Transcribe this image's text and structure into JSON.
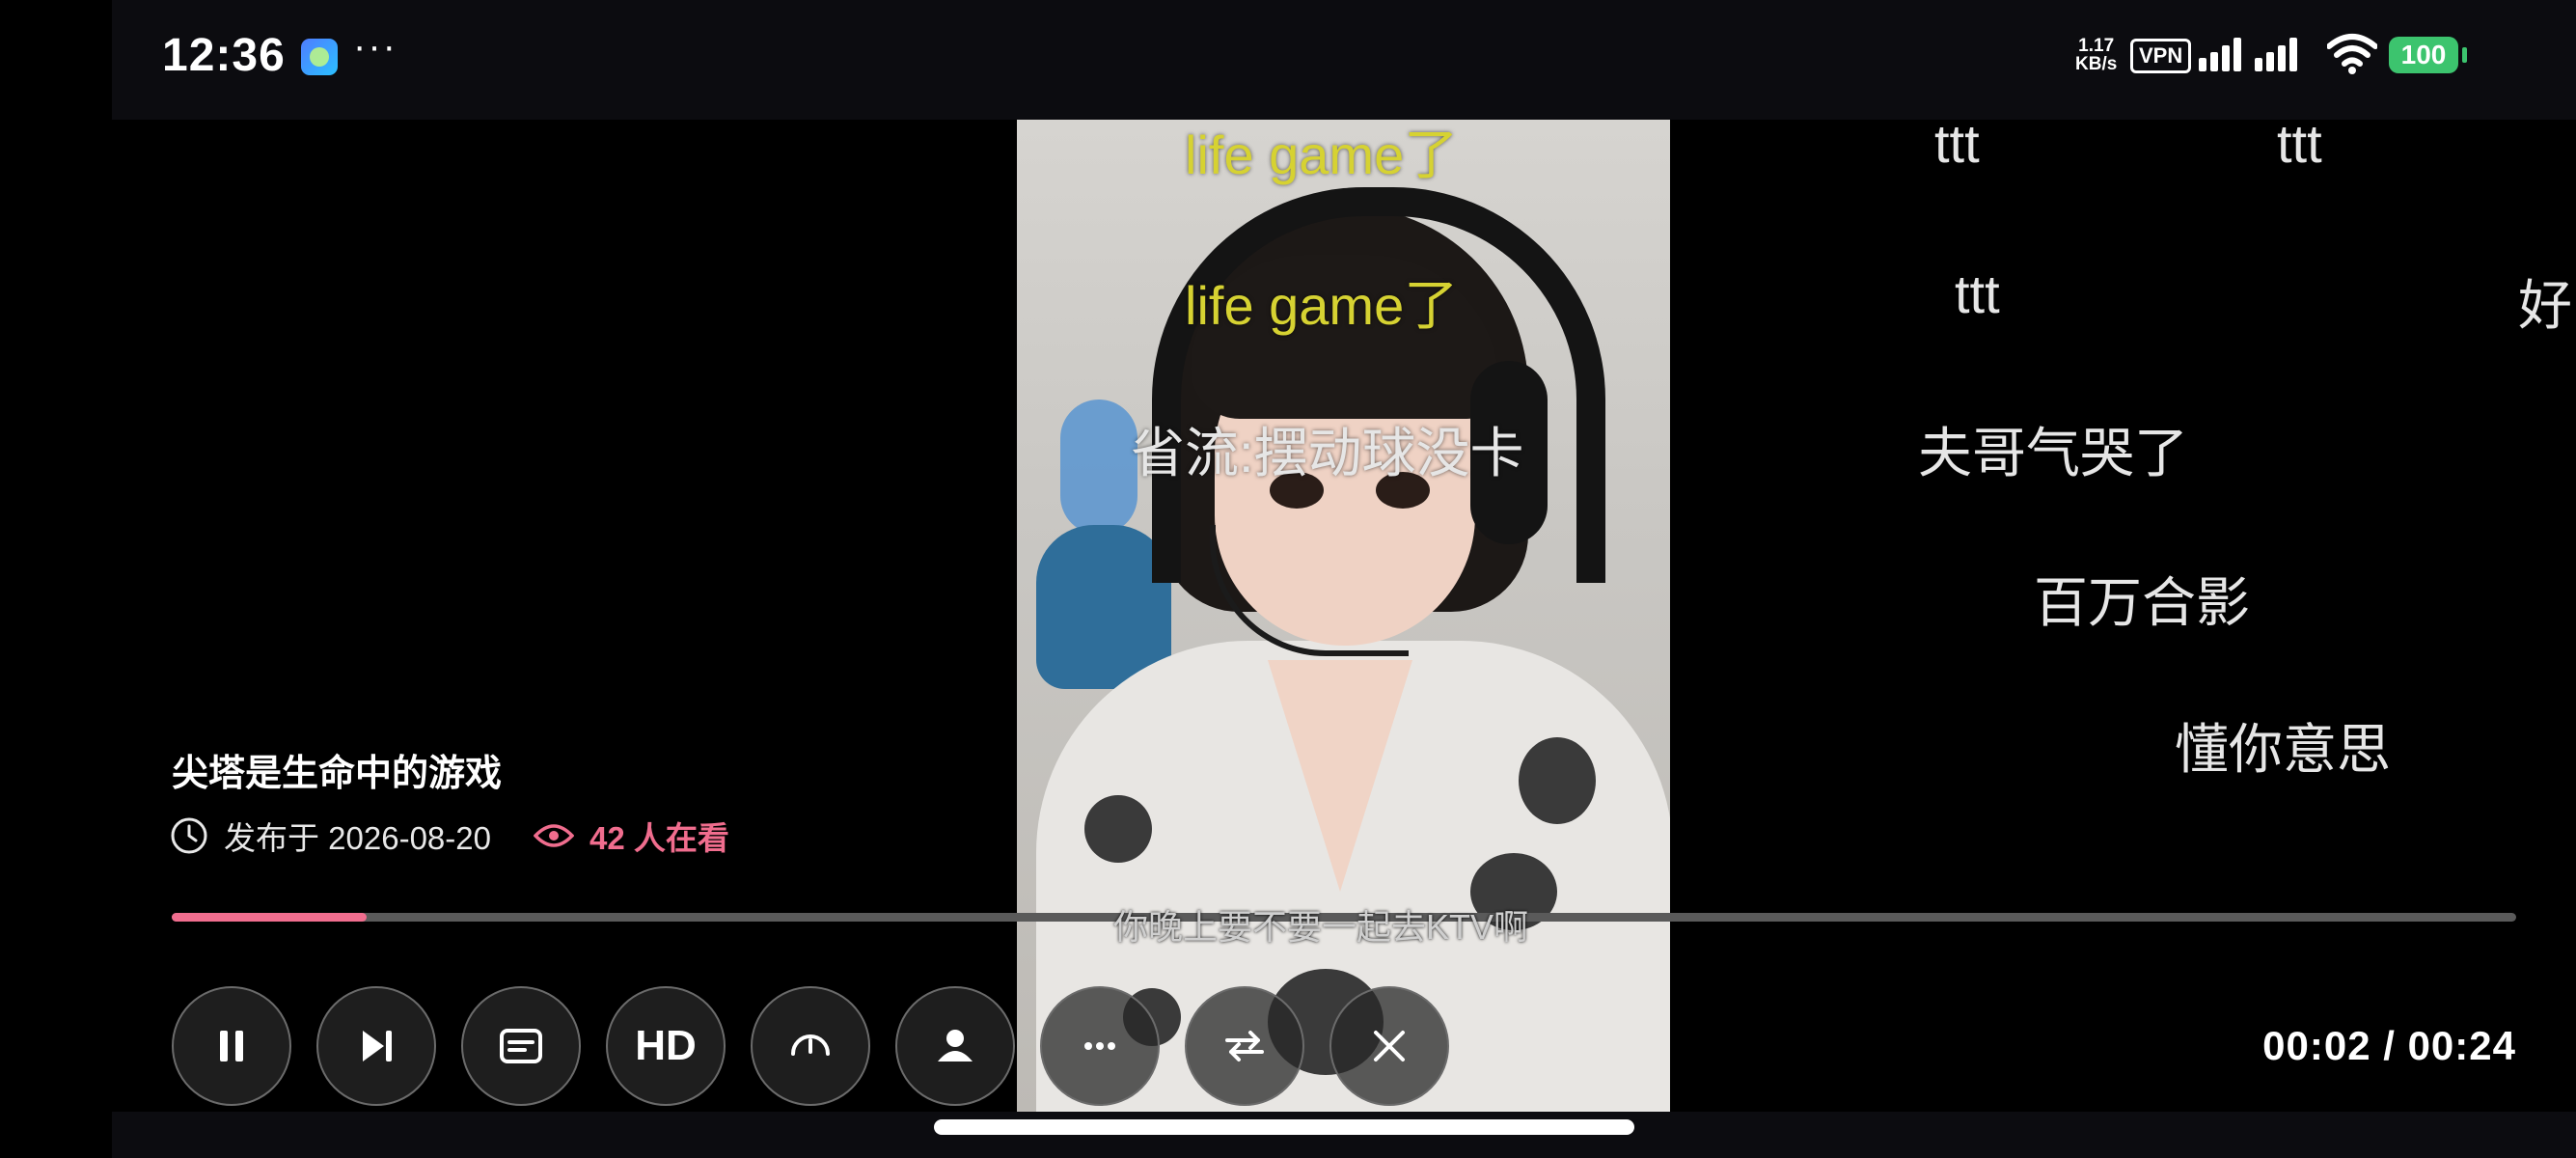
{
  "status_bar": {
    "time": "12:36",
    "more": "···",
    "net_rate_top": "1.17",
    "net_rate_bottom": "KB/s",
    "vpn": "VPN",
    "battery": "100"
  },
  "danmaku": [
    {
      "text": "life game了",
      "color": "#d6d232"
    },
    {
      "text": "life game了",
      "color": "#d6d232"
    },
    {
      "text": "省流:摆动球没卡",
      "color": "#e6e6e6"
    },
    {
      "text": "ttt",
      "color": "#e6e6e6"
    },
    {
      "text": "ttt",
      "color": "#e6e6e6"
    },
    {
      "text": "ttt",
      "color": "#e6e6e6"
    },
    {
      "text": "好",
      "color": "#e6e6e6"
    },
    {
      "text": "夫哥气哭了",
      "color": "#e6e6e6"
    },
    {
      "text": "百万合影",
      "color": "#e6e6e6"
    },
    {
      "text": "懂你意思",
      "color": "#e6e6e6"
    }
  ],
  "video": {
    "title": "尖塔是生命中的游戏",
    "published": "发布于 2026-08-20",
    "viewers": "42 人在看",
    "subtitle": "你晚上要不要一起去KTV啊"
  },
  "player": {
    "progress_fraction": 0.0833,
    "time_display": "00:02 / 00:24",
    "hd_label": "HD",
    "accent_color": "#f06d8e"
  },
  "controls": [
    {
      "name": "pause",
      "icon": "pause-icon"
    },
    {
      "name": "next",
      "icon": "skip-next-icon"
    },
    {
      "name": "danmaku",
      "icon": "subtitles-icon"
    },
    {
      "name": "quality",
      "icon": "hd-icon"
    },
    {
      "name": "speed",
      "icon": "speedometer-icon"
    },
    {
      "name": "profile",
      "icon": "person-icon"
    },
    {
      "name": "more",
      "icon": "more-icon"
    },
    {
      "name": "loop",
      "icon": "repeat-icon"
    },
    {
      "name": "close",
      "icon": "close-icon"
    }
  ]
}
